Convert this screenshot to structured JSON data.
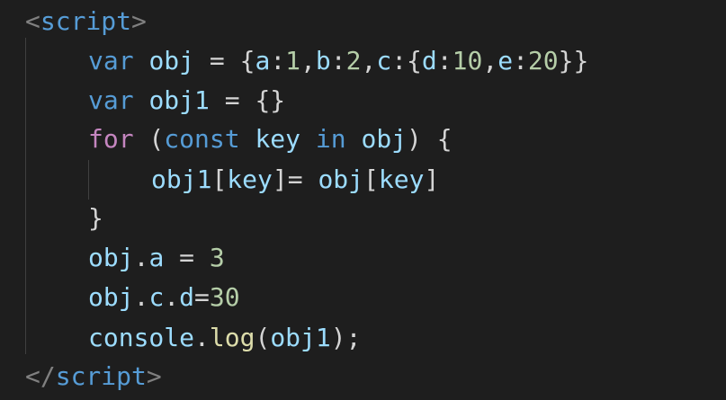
{
  "code": {
    "lines": [
      {
        "tokens": [
          [
            "tag",
            "<"
          ],
          [
            "tagname",
            "script"
          ],
          [
            "tag",
            ">"
          ]
        ]
      },
      {
        "tokens": [
          [
            "kw",
            "var"
          ],
          [
            "punc",
            " "
          ],
          [
            "var",
            "obj"
          ],
          [
            "punc",
            " = {"
          ],
          [
            "var",
            "a"
          ],
          [
            "punc",
            ":"
          ],
          [
            "num",
            "1"
          ],
          [
            "punc",
            ","
          ],
          [
            "var",
            "b"
          ],
          [
            "punc",
            ":"
          ],
          [
            "num",
            "2"
          ],
          [
            "punc",
            ","
          ],
          [
            "var",
            "c"
          ],
          [
            "punc",
            ":{"
          ],
          [
            "var",
            "d"
          ],
          [
            "punc",
            ":"
          ],
          [
            "num",
            "10"
          ],
          [
            "punc",
            ","
          ],
          [
            "var",
            "e"
          ],
          [
            "punc",
            ":"
          ],
          [
            "num",
            "20"
          ],
          [
            "punc",
            "}}"
          ]
        ]
      },
      {
        "tokens": [
          [
            "kw",
            "var"
          ],
          [
            "punc",
            " "
          ],
          [
            "var",
            "obj1"
          ],
          [
            "punc",
            " = {}"
          ]
        ]
      },
      {
        "tokens": [
          [
            "ctrl",
            "for"
          ],
          [
            "punc",
            " ("
          ],
          [
            "kw",
            "const"
          ],
          [
            "punc",
            " "
          ],
          [
            "var",
            "key"
          ],
          [
            "punc",
            " "
          ],
          [
            "kw",
            "in"
          ],
          [
            "punc",
            " "
          ],
          [
            "var",
            "obj"
          ],
          [
            "punc",
            ") {"
          ]
        ]
      },
      {
        "tokens": [
          [
            "var",
            "obj1"
          ],
          [
            "punc",
            "["
          ],
          [
            "var",
            "key"
          ],
          [
            "punc",
            "]= "
          ],
          [
            "var",
            "obj"
          ],
          [
            "punc",
            "["
          ],
          [
            "var",
            "key"
          ],
          [
            "punc",
            "]"
          ]
        ]
      },
      {
        "tokens": [
          [
            "punc",
            "}"
          ]
        ]
      },
      {
        "tokens": [
          [
            "var",
            "obj"
          ],
          [
            "punc",
            "."
          ],
          [
            "var",
            "a"
          ],
          [
            "punc",
            " = "
          ],
          [
            "num",
            "3"
          ]
        ]
      },
      {
        "tokens": [
          [
            "var",
            "obj"
          ],
          [
            "punc",
            "."
          ],
          [
            "var",
            "c"
          ],
          [
            "punc",
            "."
          ],
          [
            "var",
            "d"
          ],
          [
            "punc",
            "="
          ],
          [
            "num",
            "30"
          ]
        ]
      },
      {
        "tokens": [
          [
            "var",
            "console"
          ],
          [
            "punc",
            "."
          ],
          [
            "fn",
            "log"
          ],
          [
            "punc",
            "("
          ],
          [
            "var",
            "obj1"
          ],
          [
            "punc",
            ");"
          ]
        ]
      },
      {
        "tokens": [
          [
            "tag",
            "</"
          ],
          [
            "tagname",
            "script"
          ],
          [
            "tag",
            ">"
          ]
        ]
      }
    ]
  }
}
